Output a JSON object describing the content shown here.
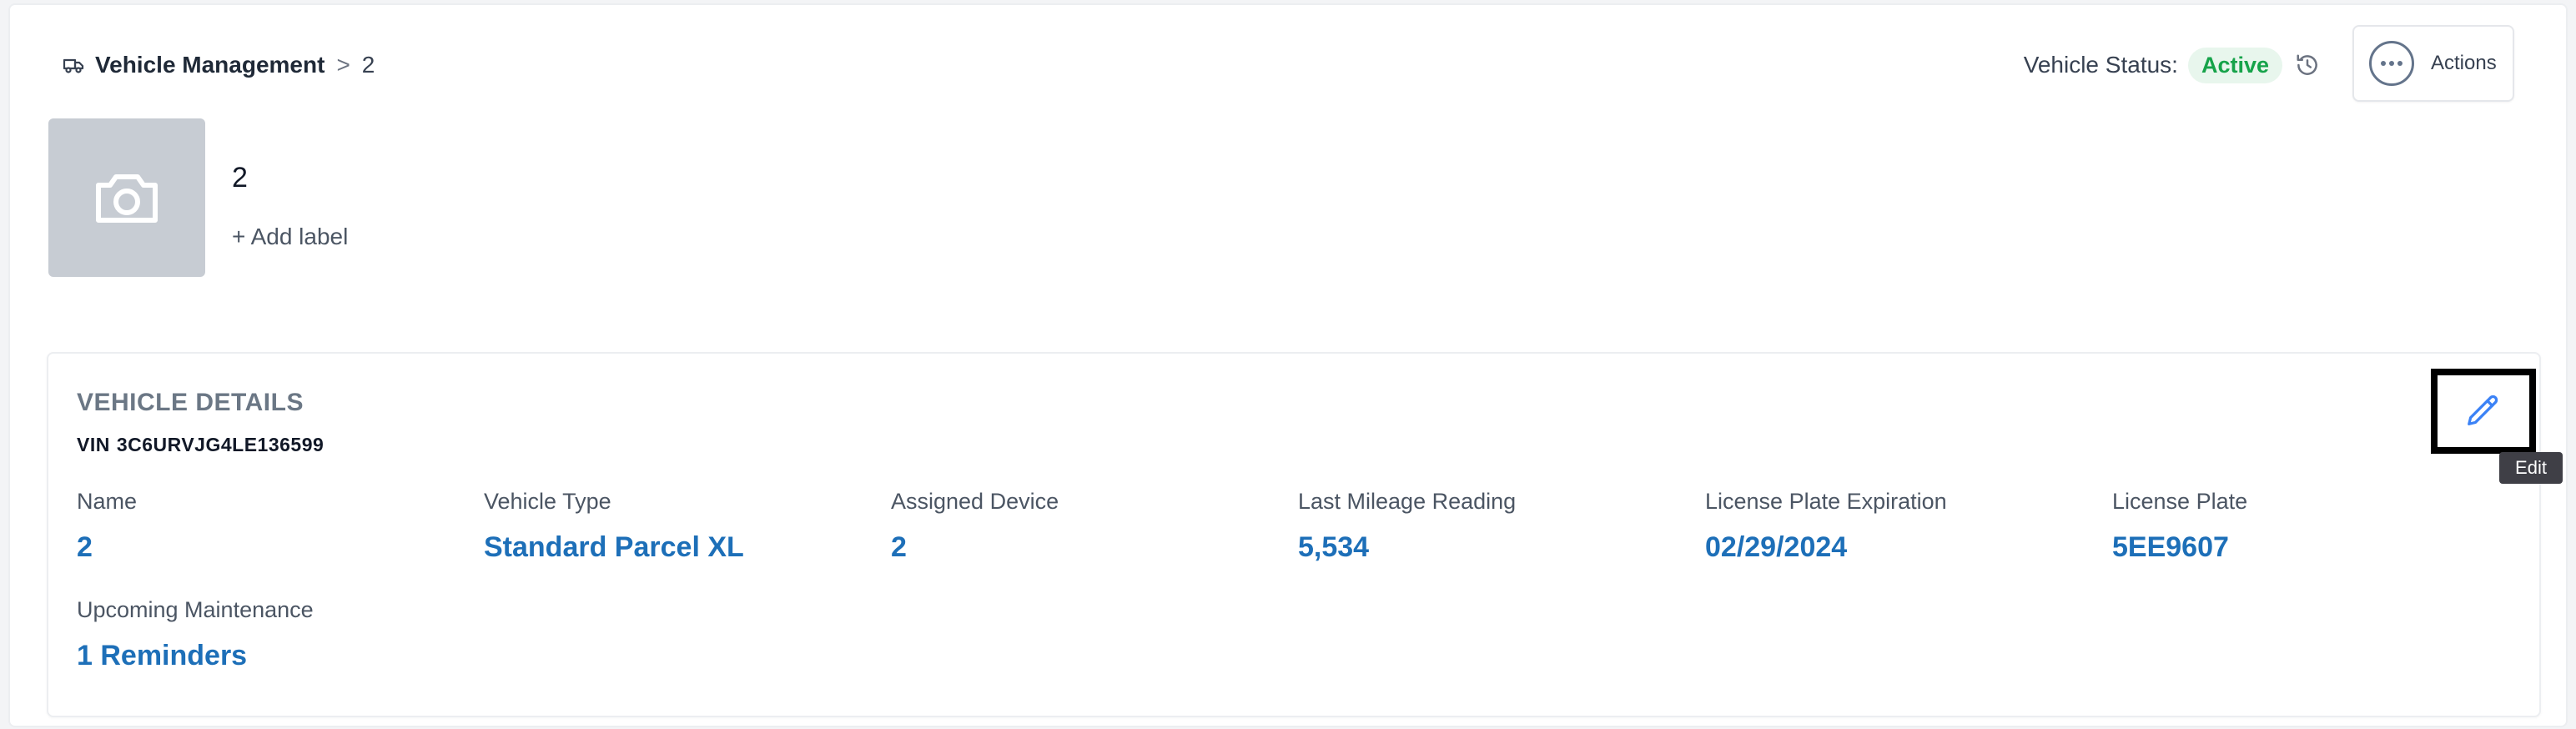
{
  "breadcrumb": {
    "root": "Vehicle Management",
    "separator": ">",
    "current": "2"
  },
  "status": {
    "label": "Vehicle Status:",
    "value": "Active",
    "color": "#16a34a"
  },
  "actions": {
    "label": "Actions"
  },
  "vehicle": {
    "name": "2",
    "add_label": "+ Add label"
  },
  "details": {
    "title": "VEHICLE DETAILS",
    "vin_prefix": "VIN",
    "vin": "3C6URVJG4LE136599",
    "fields": [
      {
        "label": "Name",
        "value": "2"
      },
      {
        "label": "Vehicle Type",
        "value": "Standard Parcel XL"
      },
      {
        "label": "Assigned Device",
        "value": "2"
      },
      {
        "label": "Last Mileage Reading",
        "value": "5,534"
      },
      {
        "label": "License Plate Expiration",
        "value": "02/29/2024"
      },
      {
        "label": "License Plate",
        "value": "5EE9607"
      },
      {
        "label": "Upcoming Maintenance",
        "value": "1 Reminders"
      }
    ]
  },
  "edit": {
    "tooltip": "Edit"
  },
  "icons": {
    "breadcrumb": "truck-icon",
    "history": "history-icon",
    "actions": "more-horizontal-icon",
    "photo": "camera-icon",
    "edit": "pencil-icon"
  },
  "colors": {
    "link": "#1d6fb8",
    "active_badge_bg": "#e8f6ed"
  }
}
